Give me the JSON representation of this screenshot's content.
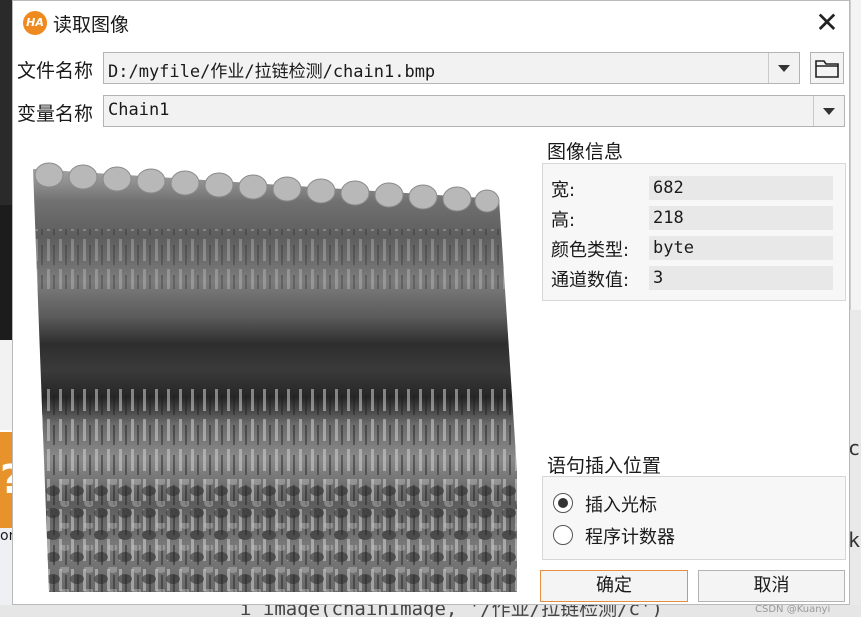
{
  "background": {
    "right_text_1": "cl",
    "right_text_2": "k",
    "left_text": "on",
    "left_badge": "?",
    "bottom_code": "i_image(chainImage, '/作业/拉链检测/c')",
    "watermark": "CSDN @Kuanyi"
  },
  "dialog": {
    "icon_text": "HA",
    "title": "读取图像",
    "close_glyph": "✕",
    "file_label": "文件名称",
    "file_value": "D:/myfile/作业/拉链检测/chain1.bmp",
    "var_label": "变量名称",
    "var_value": "Chain1",
    "info": {
      "title": "图像信息",
      "rows": [
        {
          "key": "宽:",
          "value": "682"
        },
        {
          "key": "高:",
          "value": "218"
        },
        {
          "key": "颜色类型:",
          "value": "byte"
        },
        {
          "key": "通道数值:",
          "value": "3"
        }
      ]
    },
    "insert": {
      "title": "语句插入位置",
      "options": [
        {
          "label": "插入光标",
          "selected": true
        },
        {
          "label": "程序计数器",
          "selected": false
        }
      ]
    },
    "ok_label": "确定",
    "cancel_label": "取消"
  },
  "colors": {
    "accent_orange": "#ef8a1e",
    "ok_border": "#e58f45"
  },
  "icons": {
    "app": "halcon-logo-icon",
    "folder": "folder-icon",
    "dropdown": "chevron-down-icon"
  }
}
